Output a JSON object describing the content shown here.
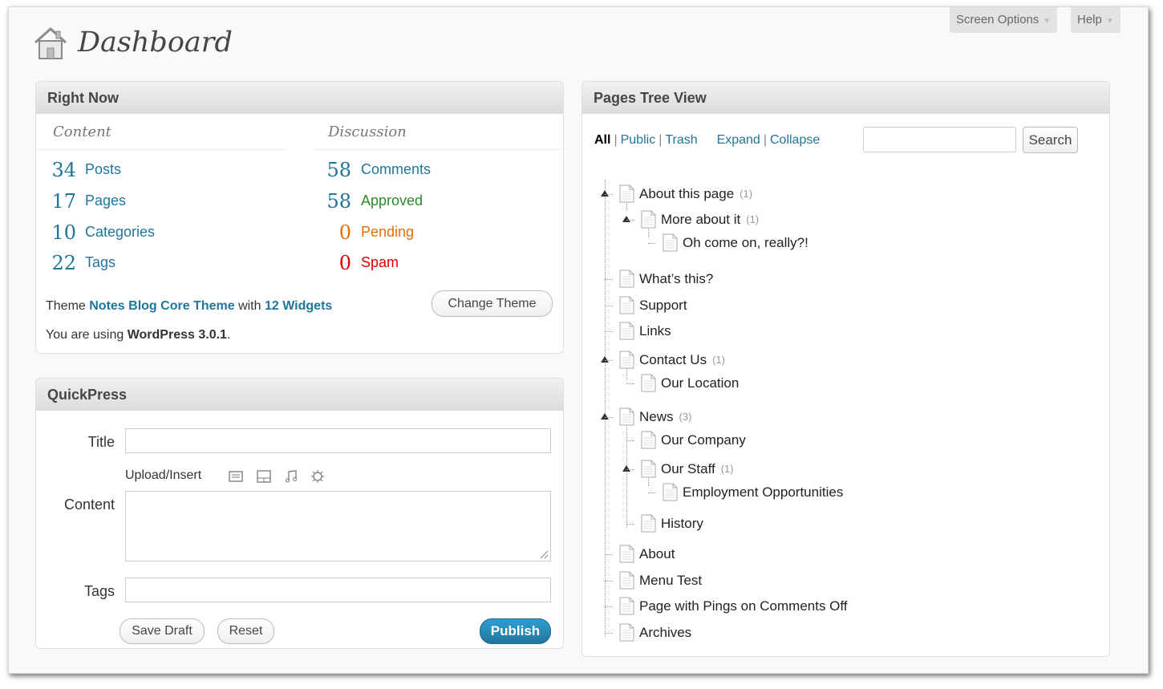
{
  "header": {
    "title": "Dashboard",
    "screen_options": "Screen Options",
    "help": "Help"
  },
  "right_now": {
    "title": "Right Now",
    "content_head": "Content",
    "discussion_head": "Discussion",
    "content": [
      {
        "count": "34",
        "label": "Posts"
      },
      {
        "count": "17",
        "label": "Pages"
      },
      {
        "count": "10",
        "label": "Categories"
      },
      {
        "count": "22",
        "label": "Tags"
      }
    ],
    "discussion": [
      {
        "count": "58",
        "label": "Comments",
        "color": "#21759b"
      },
      {
        "count": "58",
        "label": "Approved",
        "color": "#2b8b2b"
      },
      {
        "count": "0",
        "label": "Pending",
        "color": "#e66f00"
      },
      {
        "count": "0",
        "label": "Spam",
        "color": "#dd0000"
      }
    ],
    "theme_prefix": "Theme",
    "theme_name": "Notes Blog Core Theme",
    "theme_with": "with",
    "widgets": "12 Widgets",
    "change_theme": "Change Theme",
    "version_prefix": "You are using",
    "version": "WordPress 3.0.1",
    "version_suffix": "."
  },
  "quickpress": {
    "title": "QuickPress",
    "title_label": "Title",
    "upload_insert": "Upload/Insert",
    "content_label": "Content",
    "tags_label": "Tags",
    "save_draft": "Save Draft",
    "reset": "Reset",
    "publish": "Publish",
    "title_value": "",
    "content_value": "",
    "tags_value": ""
  },
  "pages_tree": {
    "title": "Pages Tree View",
    "filters": {
      "all": "All",
      "public": "Public",
      "trash": "Trash",
      "expand": "Expand",
      "collapse": "Collapse"
    },
    "search_button": "Search",
    "search_value": "",
    "nodes": [
      {
        "label": "About this page",
        "count": "(1)"
      },
      {
        "label": "More about it",
        "count": "(1)"
      },
      {
        "label": "Oh come on, really?!",
        "count": ""
      },
      {
        "label": "What’s this?",
        "count": ""
      },
      {
        "label": "Support",
        "count": ""
      },
      {
        "label": "Links",
        "count": ""
      },
      {
        "label": "Contact Us",
        "count": "(1)"
      },
      {
        "label": "Our Location",
        "count": ""
      },
      {
        "label": "News",
        "count": "(3)"
      },
      {
        "label": "Our Company",
        "count": ""
      },
      {
        "label": "Our Staff",
        "count": "(1)"
      },
      {
        "label": "Employment Opportunities",
        "count": ""
      },
      {
        "label": "History",
        "count": ""
      },
      {
        "label": "About",
        "count": ""
      },
      {
        "label": "Menu Test",
        "count": ""
      },
      {
        "label": "Page with Pings on Comments Off",
        "count": ""
      },
      {
        "label": "Archives",
        "count": ""
      }
    ]
  }
}
